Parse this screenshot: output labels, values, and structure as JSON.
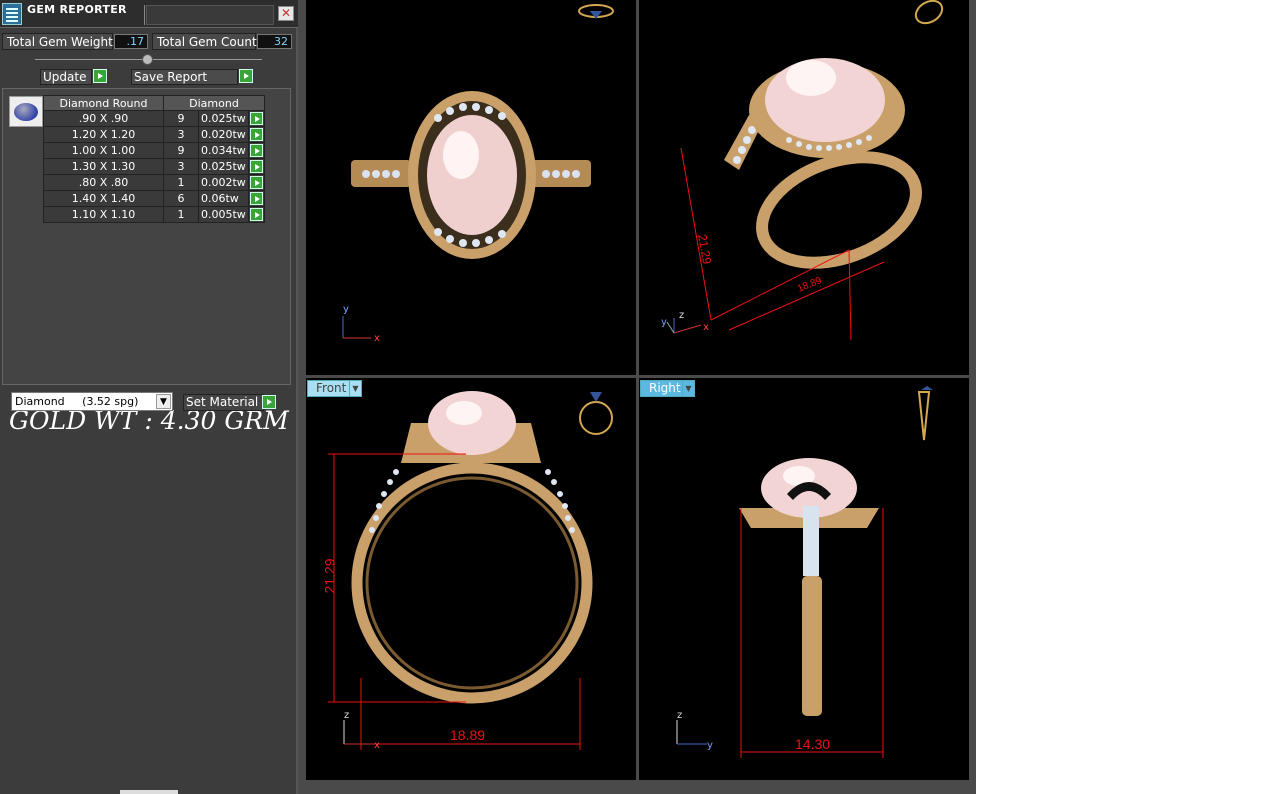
{
  "panel": {
    "title": "GEM REPORTER",
    "close_label": "✕",
    "total_weight_label": "Total Gem Weight",
    "total_weight_value": ".17",
    "total_count_label": "Total Gem Count",
    "total_count_value": "32",
    "update_label": "Update",
    "save_report_label": "Save Report",
    "table": {
      "headers": [
        "Diamond Round",
        "Diamond"
      ],
      "rows": [
        {
          "size": ".90 X .90",
          "count": "9",
          "weight": "0.025tw"
        },
        {
          "size": "1.20 X 1.20",
          "count": "3",
          "weight": "0.020tw"
        },
        {
          "size": "1.00 X 1.00",
          "count": "9",
          "weight": "0.034tw"
        },
        {
          "size": "1.30 X 1.30",
          "count": "3",
          "weight": "0.025tw"
        },
        {
          "size": ".80 X .80",
          "count": "1",
          "weight": "0.002tw"
        },
        {
          "size": "1.40 X 1.40",
          "count": "6",
          "weight": "0.06tw"
        },
        {
          "size": "1.10 X 1.10",
          "count": "1",
          "weight": "0.005tw"
        }
      ]
    },
    "gold_weight": "GOLD WT : 4.30 GRM",
    "material_value": "Diamond     (3.52 spg)",
    "set_material_label": "Set Material"
  },
  "viewports": {
    "top_right": {
      "dim_height": "21.29",
      "dim_width": "18.89"
    },
    "front": {
      "label": "Front",
      "dim_height": "21.29",
      "dim_width": "18.89"
    },
    "right": {
      "label": "Right",
      "dim_width": "14.30"
    }
  },
  "axes": {
    "x": "x",
    "y": "y",
    "z": "z"
  },
  "colors": {
    "dim_red": "#e11",
    "gold": "#c9a06a",
    "pearl": "#f3d6d6",
    "panel": "#3c3c3c",
    "viewport_label": "#a8dff2"
  }
}
